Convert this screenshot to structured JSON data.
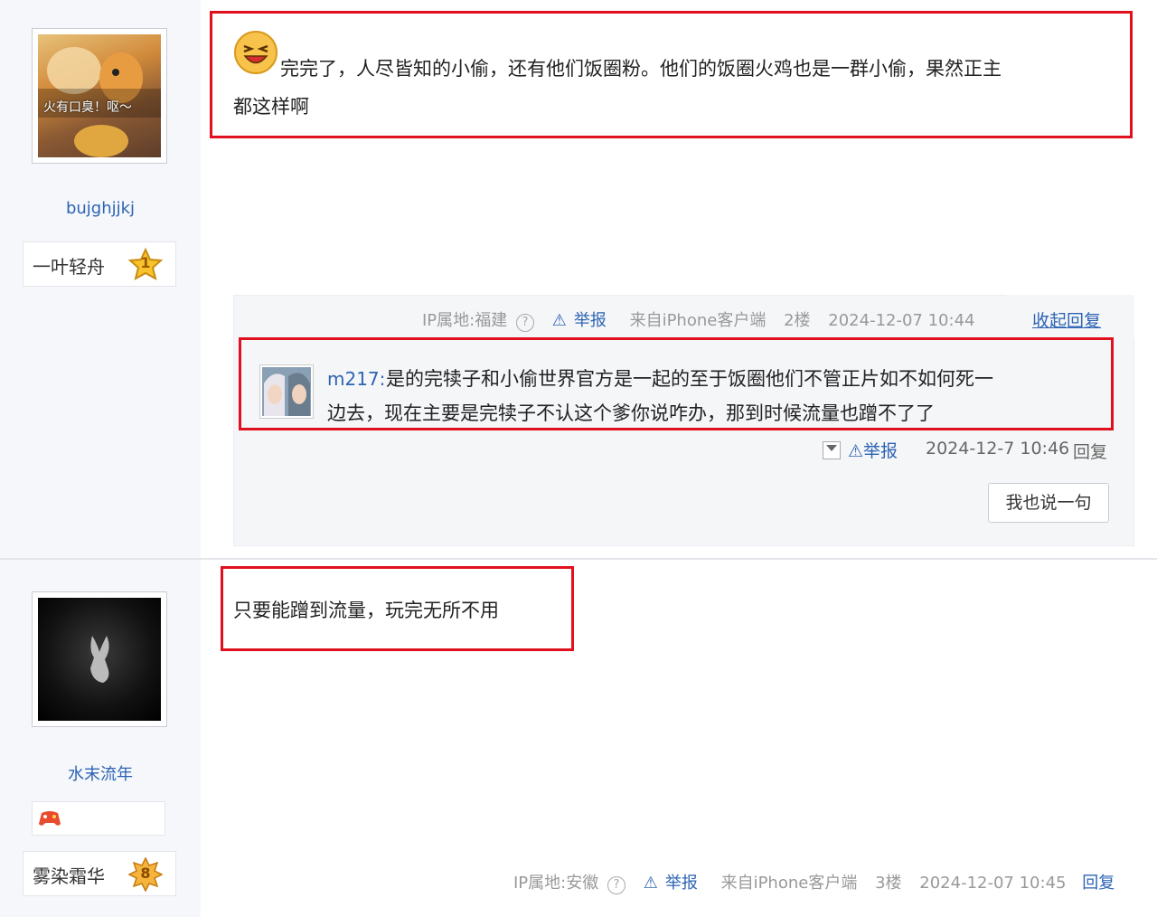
{
  "posts": [
    {
      "username": "bujghjjkj",
      "avatar_caption": "火有口臭！呕～",
      "badge": {
        "label": "一叶轻舟",
        "level": "1"
      },
      "content_line1": "完完了，人尽皆知的小偷，还有他们饭圈粉。他们的饭圈火鸡也是一群小偷，果然正主",
      "content_line2": "都这样啊",
      "meta": {
        "ip": "IP属地:福建",
        "report": "举报",
        "source": "来自iPhone客户端",
        "floor": "2楼",
        "time": "2024-12-07 10:44",
        "toggle": "收起回复"
      },
      "reply": {
        "author": "m217:",
        "text_line1": "是的完犊子和小偷世界官方是一起的至于饭圈他们不管正片如不如何死一",
        "text_line2": "边去，现在主要是完犊子不认这个爹你说咋办，那到时候流量也蹭不了了",
        "report": "举报",
        "time": "2024-12-7 10:46",
        "reply_label": "回复",
        "say_button": "我也说一句"
      }
    },
    {
      "username": "水末流年",
      "badge": {
        "label": "雾染霜华",
        "level": "8"
      },
      "content": "只要能蹭到流量，玩完无所不用",
      "meta": {
        "ip": "IP属地:安徽",
        "report": "举报",
        "source": "来自iPhone客户端",
        "floor": "3楼",
        "time": "2024-12-07 10:45",
        "reply": "回复"
      }
    }
  ],
  "colors": {
    "link": "#2d64b3",
    "highlight_border": "#e0101e",
    "meta": "#999999",
    "sidebar_bg": "#f5f7fb"
  }
}
